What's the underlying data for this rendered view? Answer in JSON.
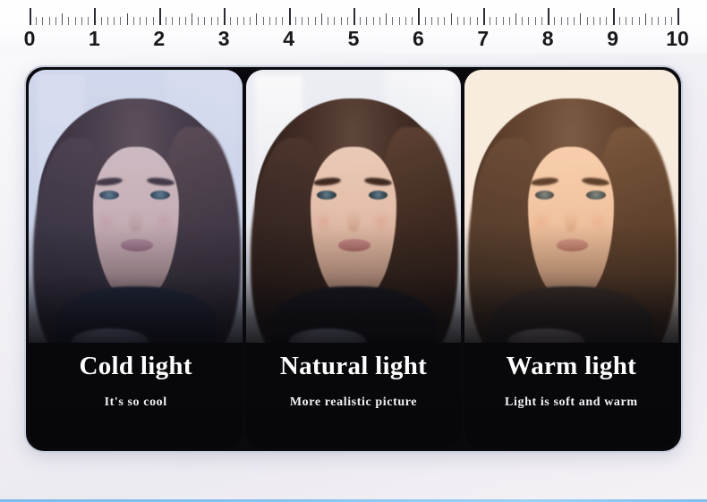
{
  "ruler": {
    "labels": [
      "0",
      "1",
      "2",
      "3",
      "4",
      "5",
      "6",
      "7",
      "8",
      "9",
      "10"
    ],
    "unit_min": 0,
    "unit_max": 10,
    "minor_per_unit": 10,
    "tick_color": "#2b2b33"
  },
  "card": {
    "background_color": "#0a0a0e",
    "border_color": "#c7cddb",
    "panels": [
      {
        "id": "cold",
        "title": "Cold light",
        "subtitle": "It's so cool",
        "tint_color": "#6076be"
      },
      {
        "id": "natural",
        "title": "Natural light",
        "subtitle": "More realistic picture",
        "tint_color": "#9496a8"
      },
      {
        "id": "warm",
        "title": "Warm light",
        "subtitle": "Light is soft and warm",
        "tint_color": "#e0a870"
      }
    ]
  },
  "page": {
    "background_color": "#f2f1f6",
    "accent_color": "#86c6ef"
  }
}
